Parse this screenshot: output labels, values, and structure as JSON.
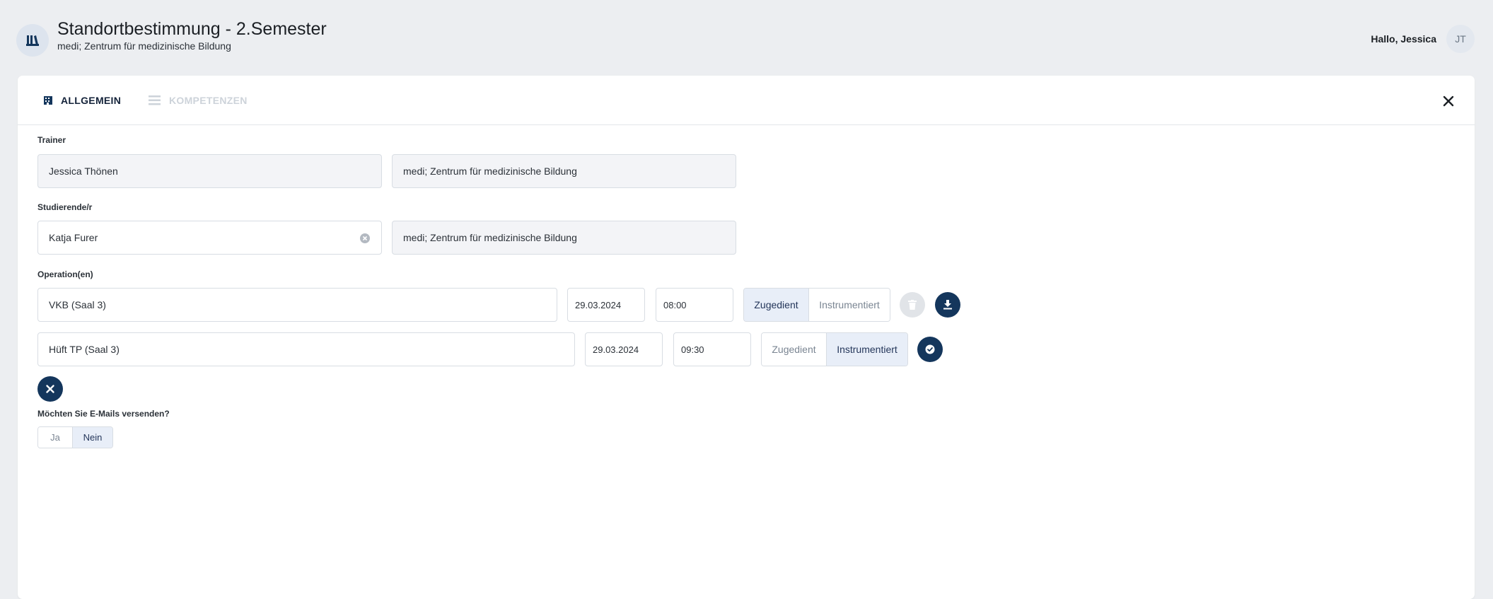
{
  "header": {
    "title": "Standortbestimmung - 2.Semester",
    "subtitle": "medi; Zentrum für medizinische Bildung",
    "greeting": "Hallo, Jessica",
    "avatar_initials": "JT",
    "logo_icon": "library-books-icon"
  },
  "tabs": [
    {
      "label": "ALLGEMEIN",
      "icon": "building-icon",
      "active": true
    },
    {
      "label": "KOMPETENZEN",
      "icon": "list-icon",
      "active": false
    }
  ],
  "form": {
    "trainer": {
      "label": "Trainer",
      "name": "Jessica Thönen",
      "organization": "medi; Zentrum für medizinische Bildung"
    },
    "student": {
      "label": "Studierende/r",
      "name": "Katja Furer",
      "organization": "medi; Zentrum für medizinische Bildung"
    },
    "operations": {
      "label": "Operation(en)",
      "rows": [
        {
          "operation": "VKB (Saal 3)",
          "date": "29.03.2024",
          "time": "08:00",
          "role_options": [
            "Zugedient",
            "Instrumentiert"
          ],
          "selected_role": "Zugedient"
        },
        {
          "operation": "Hüft TP (Saal 3)",
          "date": "29.03.2024",
          "time": "09:30",
          "role_options": [
            "Zugedient",
            "Instrumentiert"
          ],
          "selected_role": "Instrumentiert"
        }
      ]
    },
    "email": {
      "label": "Möchten Sie E-Mails versenden?",
      "options": [
        "Ja",
        "Nein"
      ],
      "selected": "Nein"
    }
  },
  "colors": {
    "background": "#eceef1",
    "primary": "#14365c",
    "selected_segment": "#e8eef8",
    "readonly_field": "#f3f4f7"
  }
}
